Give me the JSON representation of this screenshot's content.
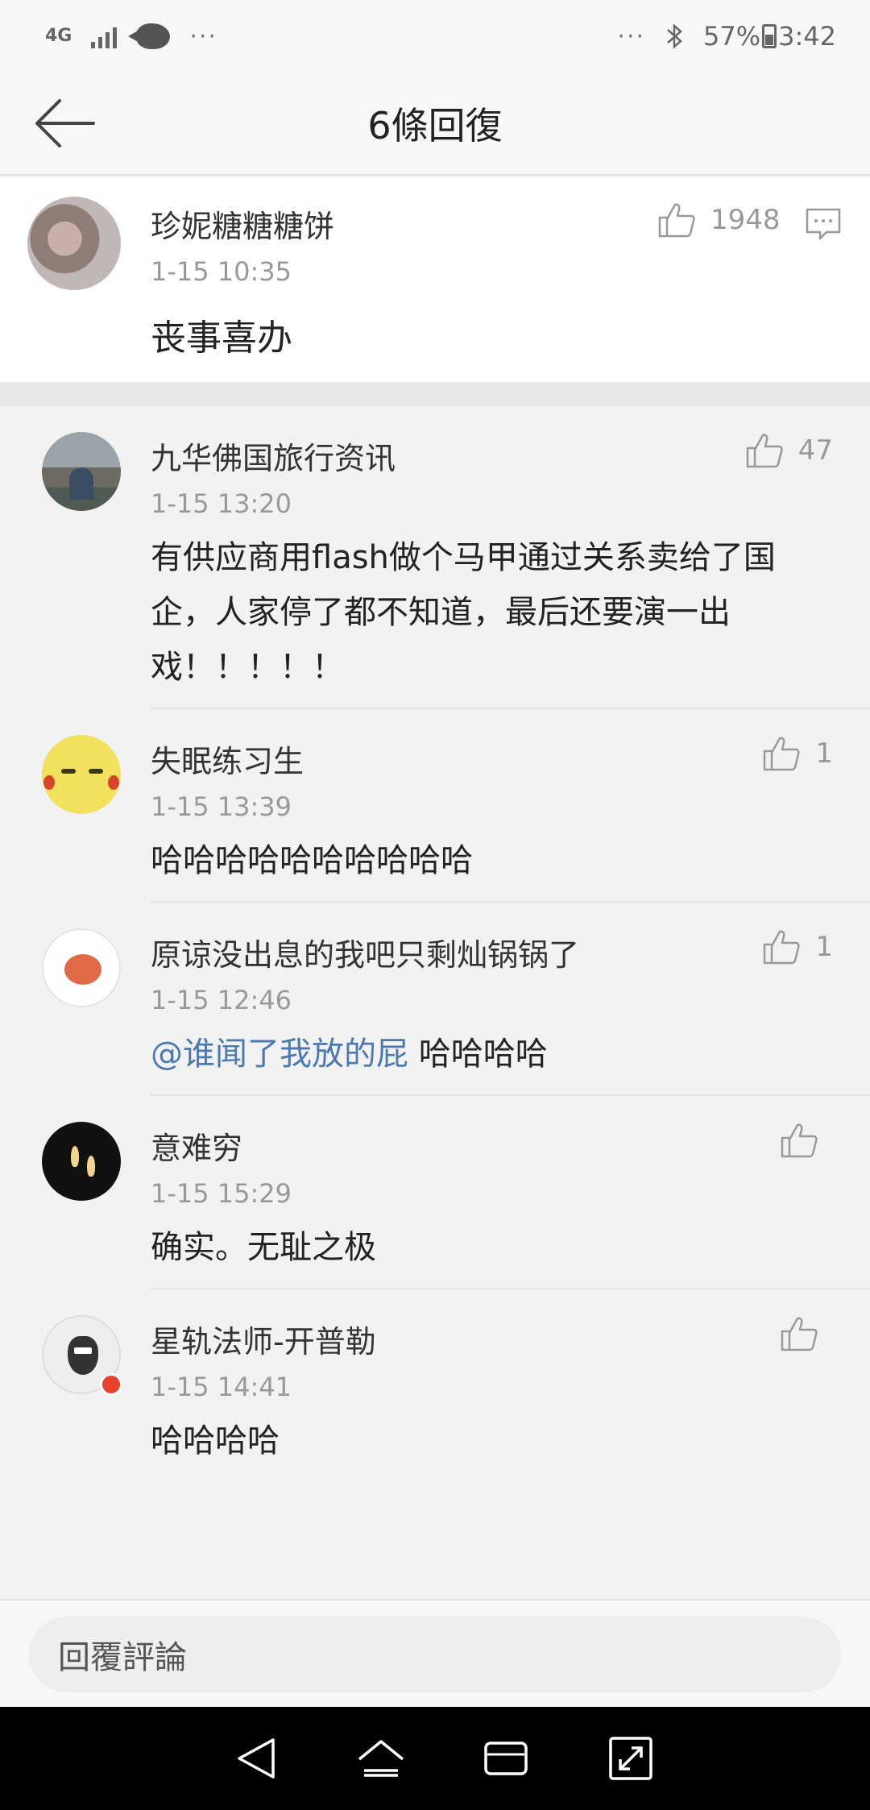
{
  "status_bar": {
    "network": "4G",
    "overflow_left": "···",
    "overflow_right": "···",
    "battery": "57%",
    "time": "3:42"
  },
  "header": {
    "title": "6條回復"
  },
  "original": {
    "author": "珍妮糖糖糖饼",
    "time": "1-15 10:35",
    "text": "丧事喜办",
    "likes": "1948"
  },
  "replies": [
    {
      "author": "九华佛国旅行资讯",
      "time": "1-15 13:20",
      "text": "有供应商用flash做个马甲通过关系卖给了国企，人家停了都不知道，最后还要演一出戏！！！！！",
      "likes": "47"
    },
    {
      "author": "失眠练习生",
      "time": "1-15 13:39",
      "text": "哈哈哈哈哈哈哈哈哈哈",
      "likes": "1"
    },
    {
      "author": "原谅没出息的我吧只剩灿锅锅了",
      "time": "1-15 12:46",
      "mention": "@谁闻了我放的屁",
      "text": " 哈哈哈哈",
      "likes": "1"
    },
    {
      "author": "意难穷",
      "time": "1-15 15:29",
      "text": "确实。无耻之极",
      "likes": ""
    },
    {
      "author": "星轨法师-开普勒",
      "time": "1-15 14:41",
      "text": "哈哈哈哈",
      "likes": ""
    }
  ],
  "input": {
    "placeholder": "回覆評論"
  },
  "icons": {
    "back": "back-arrow-icon",
    "like": "thumbs-up-icon",
    "reply": "comment-icon",
    "nav": [
      "nav-back-icon",
      "nav-home-icon",
      "nav-recents-icon",
      "nav-rotate-icon"
    ]
  }
}
